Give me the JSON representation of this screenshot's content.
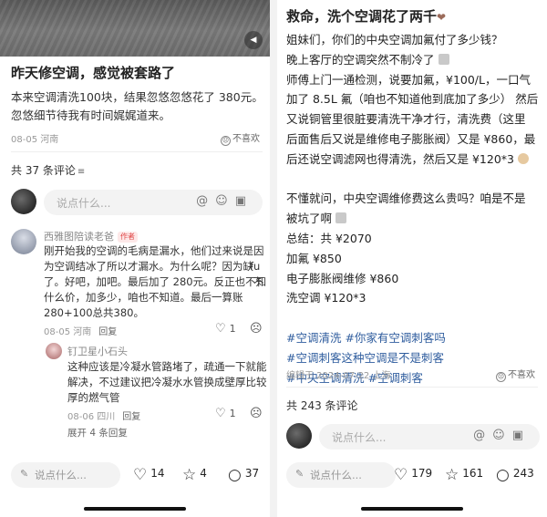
{
  "left": {
    "post": {
      "title": "昨天修空调，感觉被套路了",
      "body_lines": [
        "本来空调清洗100块，结果忽悠忽悠花了 380元。",
        "忽悠细节待我有时间娓娓道来。"
      ],
      "date_location": "08-05 河南",
      "dislike": "不喜欢"
    },
    "comments_header": {
      "count_label": "共 37 条评论",
      "filter_icon": "filter-icon"
    },
    "comment_input": {
      "placeholder": "说点什么..."
    },
    "comment1": {
      "author": "西雅图陪读老爸",
      "author_tag": "作者",
      "lines": [
        "刚开始我的空调的毛病是漏水，他们过来说是因",
        "为空调结冰了所以才漏水。为什么呢？因为缺",
        "了。好吧，加吧。最后加了 280元。反正也不知",
        "什么价，加多少，咱也不知道。最后一算账",
        "280+100总共380。"
      ],
      "side_chars": [
        "fu",
        "不"
      ],
      "date_location": "08-05 河南",
      "reply": "回复",
      "likes": "1"
    },
    "reply1": {
      "author": "钉卫星小石头",
      "lines": [
        "这种应该是冷凝水管路堵了，疏通一下就能",
        "解决，不过建议把冷凝水水管换成壁厚比较",
        "厚的燃气管"
      ],
      "date_location": "08-06 四川",
      "reply": "回复",
      "likes": "1"
    },
    "expand_label": "展开 4 条回复",
    "bottom_bar": {
      "placeholder": "说点什么...",
      "likes": "14",
      "favorites": "4",
      "comments": "37"
    }
  },
  "right": {
    "post": {
      "title": "救命，洗个空调花了两千",
      "paragraphs": [
        "姐妹们，你们的中央空调加氟付了多少钱？",
        "晚上客厅的空调突然不制冷了",
        "师傅上门一通检测，说要加氟，¥100/L，一口气",
        "加了 8.5L 氟（咱也不知道他到底加了多少） 然后",
        "又说铜管里很脏要清洗干净才行，清洗费（这里",
        "后面售后又说是维修电子膨胀阀）又是 ¥860，最",
        "后还说空调滤网也得清洗，然后又是 ¥120*3",
        "",
        "不懂就问，中央空调维修费这么贵吗？咱是不是",
        "被坑了啊",
        "总结：共 ¥2070",
        "加氟 ¥850",
        "电子膨胀阀维修 ¥860",
        "洗空调 ¥120*3",
        "",
        "#空调清洗 #你家有空调刺客吗",
        "#空调刺客这种空调是不是刺客",
        "#中央空调清洗 #空调刺客"
      ],
      "edited_meta": "编辑于 2024-07-22 上海",
      "dislike": "不喜欢"
    },
    "comments_header": {
      "count_label": "共 243 条评论"
    },
    "comment_input": {
      "placeholder": "说点什么..."
    },
    "bottom_bar": {
      "placeholder": "说点什么...",
      "likes": "179",
      "favorites": "161",
      "comments": "243"
    }
  }
}
